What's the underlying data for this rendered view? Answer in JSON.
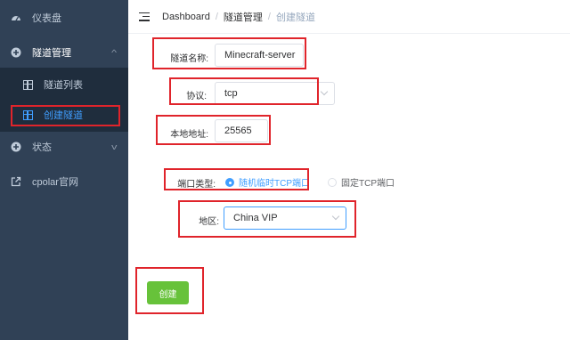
{
  "sidebar": {
    "items": [
      {
        "label": "仪表盘",
        "icon": "dashboard-icon"
      },
      {
        "label": "隧道管理",
        "icon": "plus-circle-icon"
      },
      {
        "label": "状态",
        "icon": "plus-circle-icon"
      },
      {
        "label": "cpolar官网",
        "icon": "external-link-icon"
      }
    ],
    "submenu": [
      {
        "label": "隧道列表",
        "icon": "table-icon"
      },
      {
        "label": "创建隧道",
        "icon": "table-icon"
      }
    ]
  },
  "breadcrumb": [
    "Dashboard",
    "隧道管理",
    "创建隧道"
  ],
  "form": {
    "tunnel_name": {
      "label": "隧道名称:",
      "value": "Minecraft-server"
    },
    "protocol": {
      "label": "协议:",
      "value": "tcp"
    },
    "local_address": {
      "label": "本地地址:",
      "value": "25565"
    },
    "port_type": {
      "label": "端口类型:",
      "options": [
        "随机临时TCP端口",
        "固定TCP端口"
      ],
      "selected": "随机临时TCP端口"
    },
    "region": {
      "label": "地区:",
      "value": "China VIP"
    },
    "submit_label": "创建"
  },
  "colors": {
    "sidebar_bg": "#304156",
    "accent": "#409eff",
    "success": "#67c23a",
    "highlight_box": "#e0242b"
  }
}
